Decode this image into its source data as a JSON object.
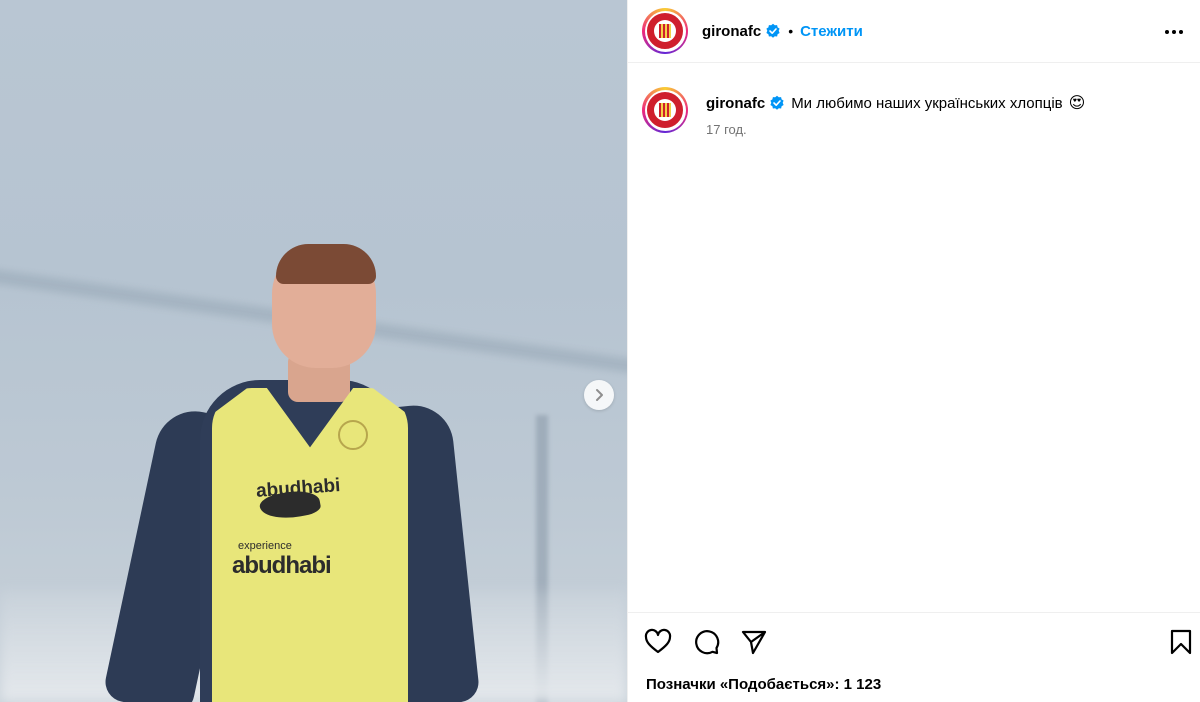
{
  "post": {
    "username": "gironafc",
    "follow_label": "Стежити",
    "separator": "•",
    "caption": "Ми любимо наших українських хлопців",
    "caption_emoji": "😍",
    "time_ago": "17 год.",
    "likes_text": "Позначки «Подобається»: 1 123"
  },
  "media": {
    "bib_sponsor_top": "abudhabi",
    "bib_sponsor_small": "experience",
    "bib_sponsor_big": "abudhabi"
  },
  "colors": {
    "accent": "#0095f6",
    "club_red": "#cf1f2d",
    "bib_yellow": "#e8e67a"
  },
  "icons": [
    "chevron-right-icon",
    "verified-badge-icon",
    "more-options-icon",
    "heart-icon",
    "comment-icon",
    "share-icon",
    "bookmark-icon"
  ]
}
